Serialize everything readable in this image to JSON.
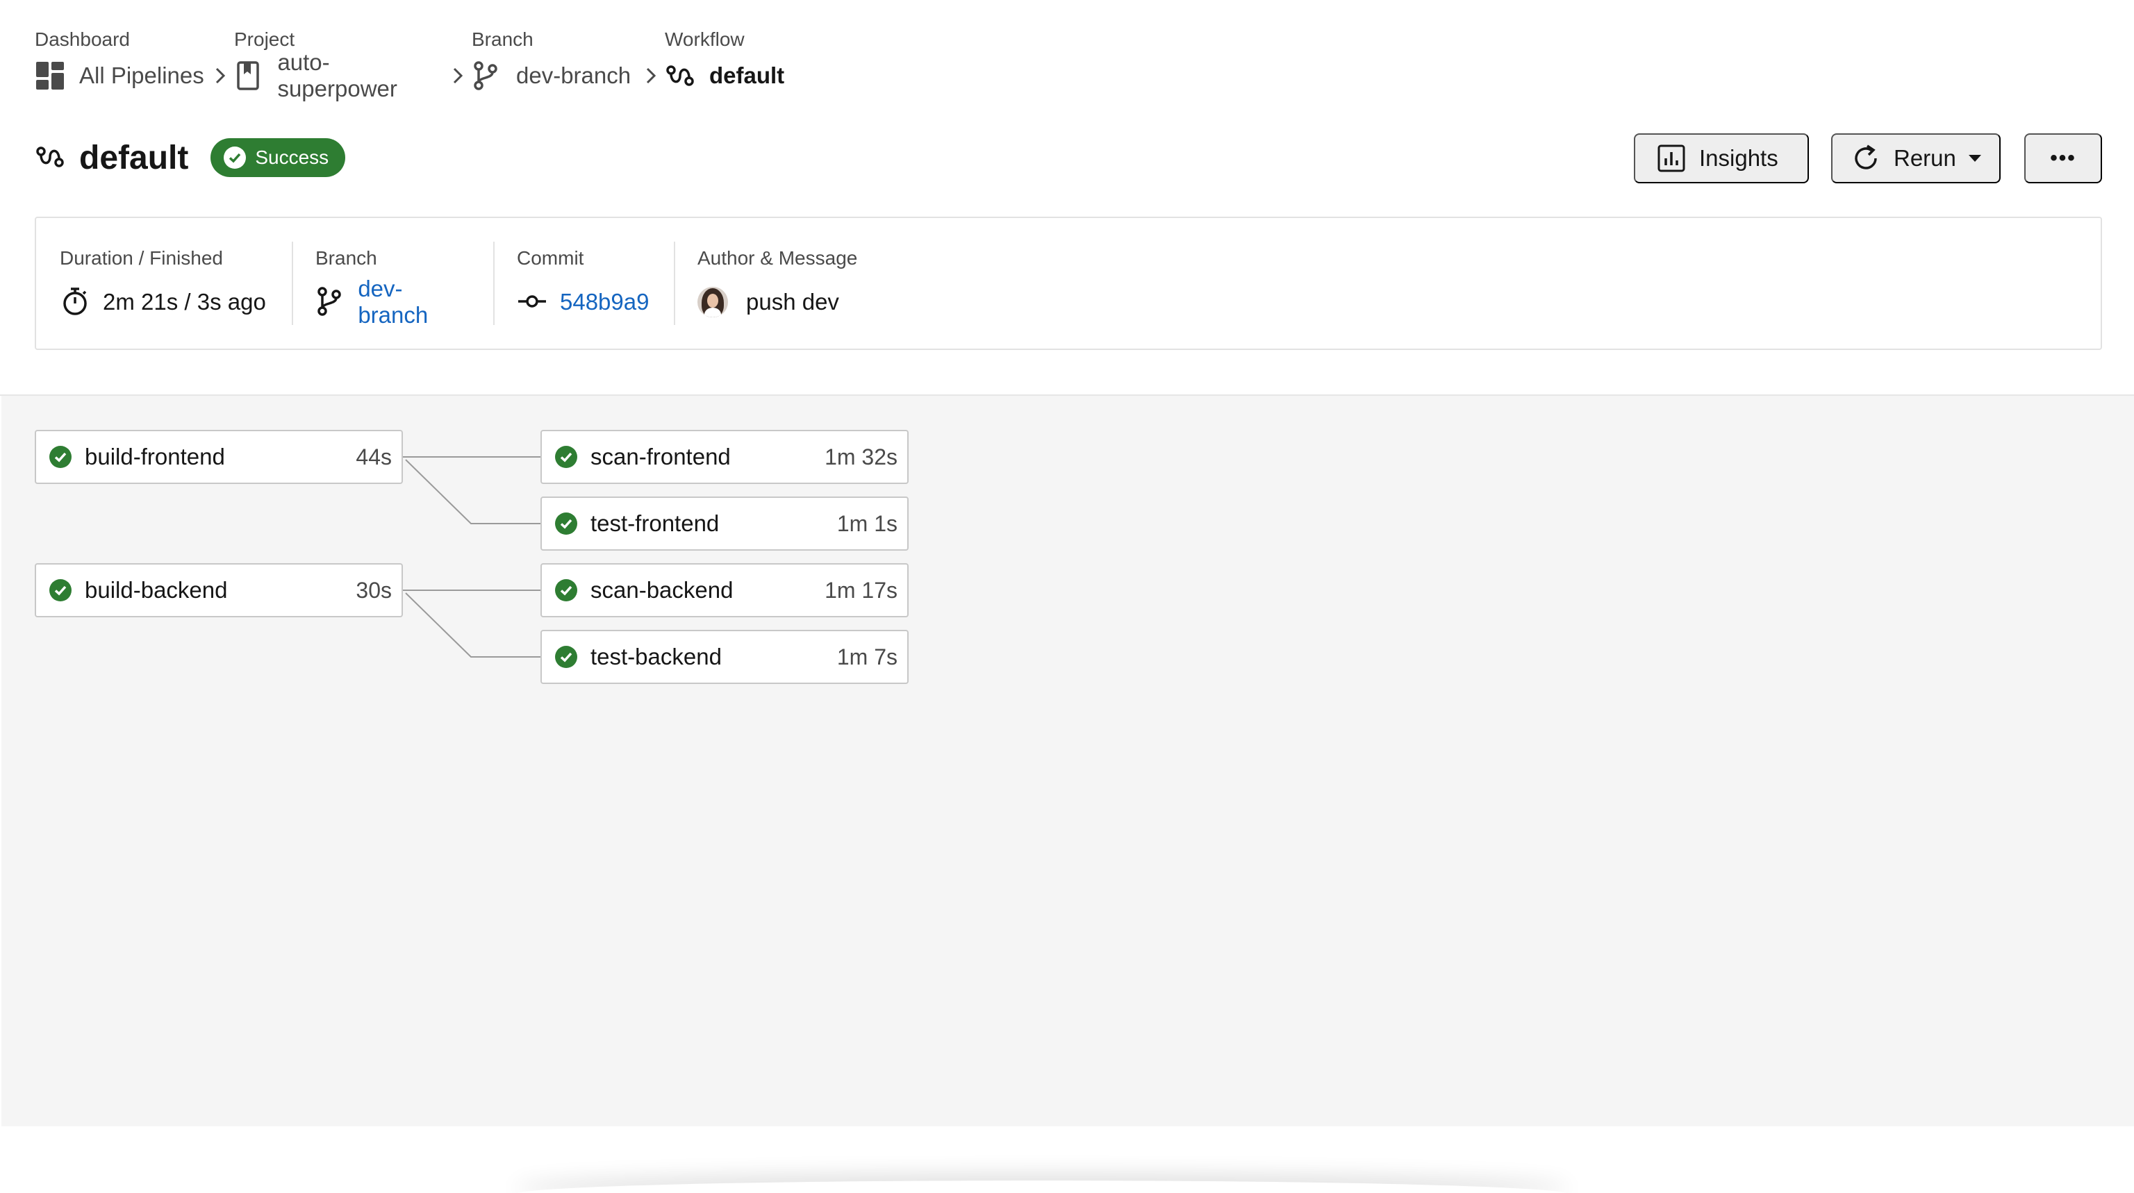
{
  "breadcrumbs": [
    {
      "label": "Dashboard",
      "value": "All Pipelines",
      "icon": "dashboard-icon"
    },
    {
      "label": "Project",
      "value": "auto-superpower",
      "icon": "bookmark-icon"
    },
    {
      "label": "Branch",
      "value": "dev-branch",
      "icon": "branch-icon"
    },
    {
      "label": "Workflow",
      "value": "default",
      "icon": "workflow-icon"
    }
  ],
  "header": {
    "title": "default",
    "status": "Success",
    "status_color": "#2e7d32",
    "insights_label": "Insights",
    "rerun_label": "Rerun",
    "more_label": "•••"
  },
  "info": {
    "duration": {
      "label": "Duration / Finished",
      "value": "2m 21s / 3s ago"
    },
    "branch": {
      "label": "Branch",
      "value": "dev-branch"
    },
    "commit": {
      "label": "Commit",
      "value": "548b9a9"
    },
    "author": {
      "label": "Author & Message",
      "value": "push dev"
    }
  },
  "jobs": {
    "build_frontend": {
      "name": "build-frontend",
      "duration": "44s",
      "status": "success"
    },
    "scan_frontend": {
      "name": "scan-frontend",
      "duration": "1m 32s",
      "status": "success"
    },
    "test_frontend": {
      "name": "test-frontend",
      "duration": "1m 1s",
      "status": "success"
    },
    "build_backend": {
      "name": "build-backend",
      "duration": "30s",
      "status": "success"
    },
    "scan_backend": {
      "name": "scan-backend",
      "duration": "1m 17s",
      "status": "success"
    },
    "test_backend": {
      "name": "test-backend",
      "duration": "1m 7s",
      "status": "success"
    }
  },
  "colors": {
    "success": "#2e7d32",
    "link": "#1565c0"
  }
}
